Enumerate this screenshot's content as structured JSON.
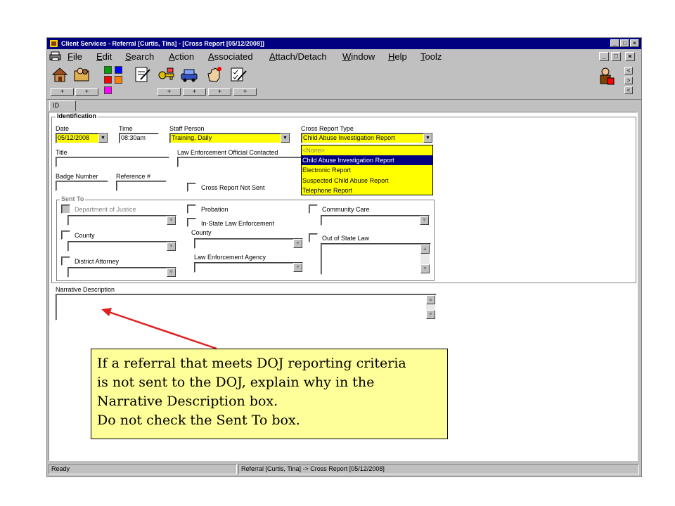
{
  "window": {
    "title": "Client Services - Referral [Curtis, Tina] - [Cross Report [05/12/2008]]",
    "controls": [
      "_",
      "□",
      "×"
    ]
  },
  "menu": {
    "items": [
      "File",
      "Edit",
      "Search",
      "Action",
      "Associated",
      "Attach/Detach",
      "Window",
      "Help",
      "Toolz"
    ],
    "controls": [
      "_",
      "□",
      "×"
    ]
  },
  "toolbar": {
    "tool_icons": [
      "house-icon",
      "folder-people-icon",
      "notepad-icon",
      "key-icon",
      "car-icon",
      "hand-icon",
      "checklist-icon"
    ],
    "plus_label": "+",
    "swatch_colors": [
      "#00a000",
      "#0000ff",
      "#ff0000",
      "#ff8000",
      "#ff00ff"
    ],
    "side_buttons": [
      "<",
      ">",
      "<"
    ]
  },
  "tabs": {
    "active": "ID"
  },
  "identification": {
    "title": "Identification",
    "date": {
      "label": "Date",
      "value": "05/12/2008"
    },
    "time": {
      "label": "Time",
      "value": "08:30am"
    },
    "staff_person": {
      "label": "Staff Person",
      "value": "Training, Daily"
    },
    "cross_report_type": {
      "label": "Cross Report Type",
      "value": "Child Abuse Investigation Report",
      "options": [
        "<None>",
        "Child Abuse Investigation Report",
        "Electronic Report",
        "Suspected Child Abuse Report",
        "Telephone Report"
      ],
      "selected_index": 1
    },
    "title_field": {
      "label": "Title",
      "value": ""
    },
    "law_enforcement_official": {
      "label": "Law Enforcement Official Contacted",
      "value": ""
    },
    "badge_number": {
      "label": "Badge Number",
      "value": ""
    },
    "reference": {
      "label": "Reference #",
      "value": ""
    },
    "cross_report_not_sent": {
      "label": "Cross Report Not Sent",
      "checked": false
    }
  },
  "sent_to": {
    "title": "Sent To",
    "department_of_justice": {
      "label": "Department of Justice",
      "enabled": false
    },
    "county": {
      "label": "County"
    },
    "district_attorney": {
      "label": "District Attorney"
    },
    "probation": {
      "label": "Probation"
    },
    "in_state_law": {
      "label": "In-State Law Enforcement",
      "county_label": "County",
      "agency_label": "Law Enforcement Agency"
    },
    "community_care": {
      "label": "Community Care"
    },
    "out_of_state_law": {
      "label": "Out of State Law"
    }
  },
  "narrative": {
    "label": "Narrative Description",
    "value": ""
  },
  "status": {
    "left": "Ready",
    "right": "Referral [Curtis, Tina] -> Cross Report [05/12/2008]"
  },
  "callout": {
    "lines": [
      "If a referral that meets DOJ reporting criteria",
      "is not sent to the DOJ, explain why in the",
      "Narrative Description box.",
      "Do not check the Sent To box."
    ],
    "arrow_color": "#e02020"
  }
}
